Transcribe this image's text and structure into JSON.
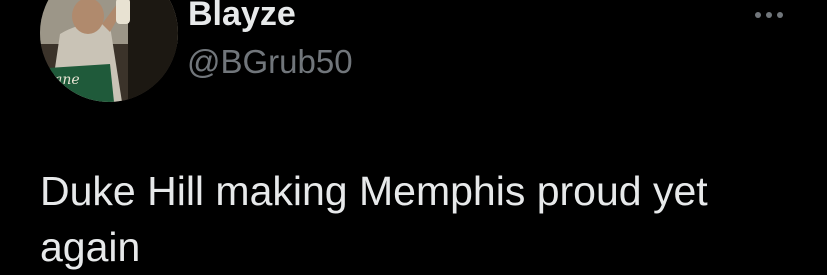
{
  "tweet": {
    "author": {
      "display_name": "Blayze",
      "handle": "@BGrub50",
      "avatar_icon": "profile-photo"
    },
    "more_icon": "ellipsis-icon",
    "text": "Duke Hill making Memphis proud yet again"
  },
  "colors": {
    "background": "#000000",
    "primary_text": "#e7e9ea",
    "secondary_text": "#71767b"
  }
}
